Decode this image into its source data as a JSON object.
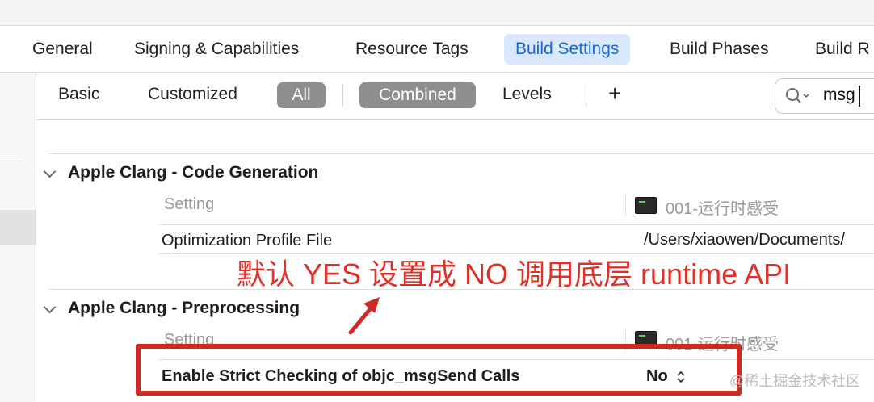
{
  "tabs": {
    "general": "General",
    "signing": "Signing & Capabilities",
    "resource_tags": "Resource Tags",
    "build_settings": "Build Settings",
    "build_phases": "Build Phases",
    "build_rules": "Build R"
  },
  "filter_bar": {
    "basic": "Basic",
    "customized": "Customized",
    "all": "All",
    "combined": "Combined",
    "levels": "Levels",
    "add": "+",
    "search_value": "msg"
  },
  "sections": [
    {
      "title": "Apple Clang - Code Generation",
      "column_header": "Setting",
      "target_header": "001-运行时感受",
      "rows": [
        {
          "setting": "Optimization Profile File",
          "value": "/Users/xiaowen/Documents/"
        }
      ]
    },
    {
      "title": "Apple Clang - Preprocessing",
      "column_header": "Setting",
      "target_header": "001-运行时感受",
      "rows": [
        {
          "setting": "Enable Strict Checking of objc_msgSend Calls",
          "value": "No"
        }
      ]
    }
  ],
  "annotation": {
    "text": "默认 YES 设置成 NO 调用底层 runtime API",
    "color": "#e03028"
  },
  "watermark": "@稀土掘金技术社区",
  "colors": {
    "accent": "#1a66d6",
    "tab_active_bg": "#d9e9fb",
    "pill_bg": "#8e8e8e",
    "annotation_red": "#cc2b24"
  }
}
